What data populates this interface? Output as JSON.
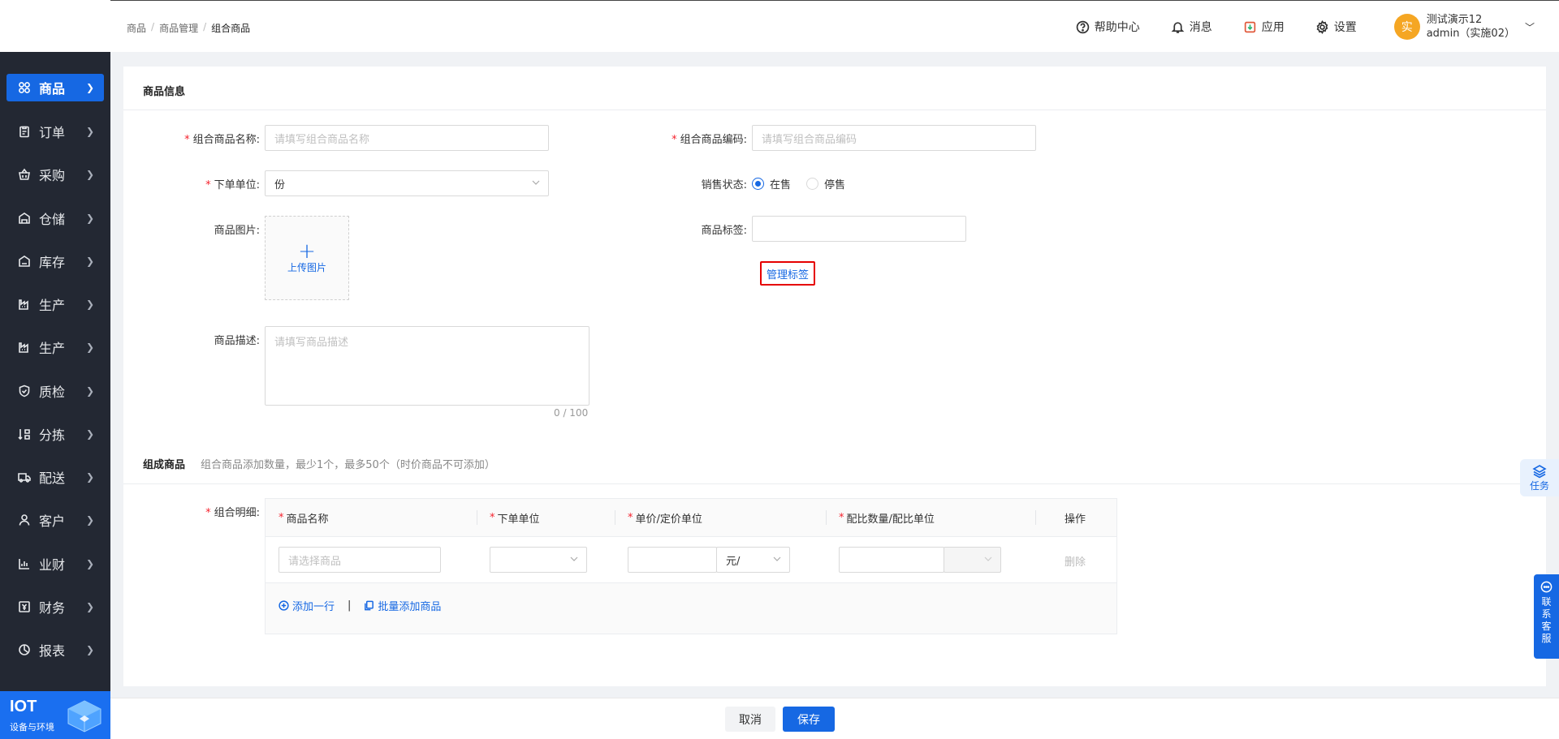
{
  "sidebar": {
    "items": [
      {
        "label": "商品",
        "icon": "grid-icon"
      },
      {
        "label": "订单",
        "icon": "clipboard-icon"
      },
      {
        "label": "采购",
        "icon": "basket-icon"
      },
      {
        "label": "仓储",
        "icon": "warehouse-icon"
      },
      {
        "label": "库存",
        "icon": "inventory-icon"
      },
      {
        "label": "生产",
        "icon": "factory-icon"
      },
      {
        "label": "生产",
        "icon": "factory-icon"
      },
      {
        "label": "质检",
        "icon": "shield-icon"
      },
      {
        "label": "分拣",
        "icon": "sort-icon"
      },
      {
        "label": "配送",
        "icon": "truck-icon"
      },
      {
        "label": "客户",
        "icon": "user-icon"
      },
      {
        "label": "业财",
        "icon": "chart-icon"
      },
      {
        "label": "财务",
        "icon": "finance-icon"
      },
      {
        "label": "报表",
        "icon": "pie-icon"
      }
    ],
    "iot_title": "IOT",
    "iot_subtitle": "设备与环境"
  },
  "header": {
    "breadcrumb": [
      "商品",
      "商品管理",
      "组合商品"
    ],
    "help": "帮助中心",
    "messages": "消息",
    "apps": "应用",
    "settings": "设置",
    "avatar_char": "实",
    "user_name": "测试演示12",
    "user_account": "admin（实施02）"
  },
  "form": {
    "section_info": "商品信息",
    "name_label": "组合商品名称:",
    "name_placeholder": "请填写组合商品名称",
    "code_label": "组合商品编码:",
    "code_placeholder": "请填写组合商品编码",
    "unit_label": "下单单位:",
    "unit_value": "份",
    "status_label": "销售状态:",
    "status_on": "在售",
    "status_off": "停售",
    "image_label": "商品图片:",
    "upload_label": "上传图片",
    "tag_label": "商品标签:",
    "manage_tags": "管理标签",
    "desc_label": "商品描述:",
    "desc_placeholder": "请填写商品描述",
    "desc_counter": "0 / 100"
  },
  "compose": {
    "section_title": "组成商品",
    "hint": "组合商品添加数量，最少1个，最多50个（时价商品不可添加）",
    "detail_label": "组合明细:",
    "columns": {
      "name": "商品名称",
      "unit": "下单单位",
      "price": "单价/定价单位",
      "ratio": "配比数量/配比单位",
      "action": "操作"
    },
    "row": {
      "name_placeholder": "请选择商品",
      "price_unit": "元/",
      "delete": "删除"
    },
    "add_row": "添加一行",
    "batch_add": "批量添加商品"
  },
  "footer": {
    "cancel": "取消",
    "save": "保存"
  },
  "floats": {
    "task": "任务",
    "service": [
      "联",
      "系",
      "客",
      "服"
    ]
  }
}
